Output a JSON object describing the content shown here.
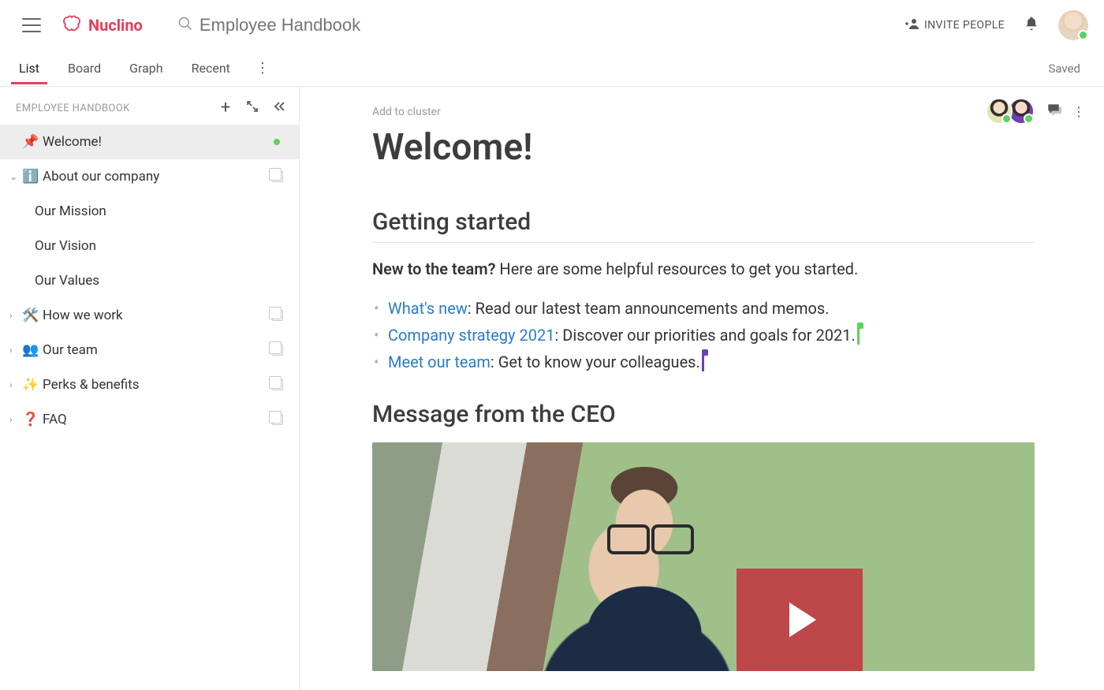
{
  "brand": {
    "name": "Nuclino"
  },
  "search": {
    "placeholder": "Employee Handbook"
  },
  "header": {
    "invite_label": "INVITE PEOPLE",
    "saved_label": "Saved"
  },
  "tabs": {
    "items": [
      "List",
      "Board",
      "Graph",
      "Recent"
    ],
    "active": 0
  },
  "sidebar": {
    "title": "EMPLOYEE HANDBOOK",
    "items": [
      {
        "emoji": "📌",
        "label": "Welcome!",
        "active": true,
        "has_green_dot": true
      },
      {
        "emoji": "ℹ️",
        "label": "About our company",
        "expanded": true,
        "children": [
          "Our Mission",
          "Our Vision",
          "Our Values"
        ]
      },
      {
        "emoji": "🛠️",
        "label": "How we work"
      },
      {
        "emoji": "👥",
        "label": "Our team"
      },
      {
        "emoji": "✨",
        "label": "Perks & benefits"
      },
      {
        "emoji": "❓",
        "label": "FAQ"
      }
    ]
  },
  "doc": {
    "add_cluster": "Add to cluster",
    "title": "Welcome!",
    "section1": "Getting started",
    "intro_bold": "New to the team?",
    "intro_rest": " Here are some helpful resources to get you started.",
    "bullets": [
      {
        "link": "What's new",
        "rest": ": Read our latest team announcements and memos."
      },
      {
        "link": "Company strategy 2021",
        "rest": ": Discover our priorities and goals for 2021.",
        "cursor": "green"
      },
      {
        "link": "Meet our team",
        "rest": ": Get to know your colleagues.",
        "cursor": "purple"
      }
    ],
    "section2": "Message from the CEO"
  }
}
